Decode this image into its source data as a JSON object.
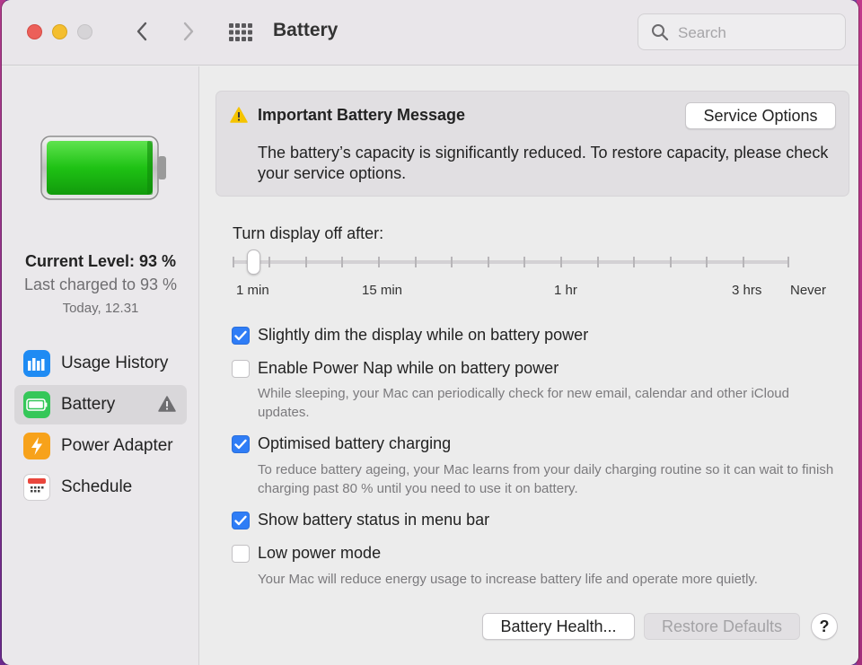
{
  "window": {
    "title": "Battery",
    "search_placeholder": "Search"
  },
  "sidebar": {
    "level_current": "Current Level: 93 %",
    "level_last_charged": "Last charged to 93 %",
    "level_time": "Today, 12.31",
    "items": [
      {
        "label": "Usage History",
        "icon": "bar-chart-icon",
        "color": "#1f8bf3"
      },
      {
        "label": "Battery",
        "icon": "battery-icon",
        "color": "#35c759",
        "active": true,
        "warning": true
      },
      {
        "label": "Power Adapter",
        "icon": "lightning-icon",
        "color": "#f7a21b"
      },
      {
        "label": "Schedule",
        "icon": "calendar-icon",
        "color": "#e9463c"
      }
    ]
  },
  "message": {
    "title": "Important Battery Message",
    "body": "The battery’s capacity is significantly reduced. To restore capacity, please check your service options.",
    "button": "Service Options"
  },
  "display_off": {
    "label": "Turn display off after:",
    "tick_labels": [
      "1 min",
      "15 min",
      "1 hr",
      "3 hrs",
      "Never"
    ],
    "value": "1 min"
  },
  "options": [
    {
      "label": "Slightly dim the display while on battery power",
      "checked": true,
      "description": ""
    },
    {
      "label": "Enable Power Nap while on battery power",
      "checked": false,
      "description": "While sleeping, your Mac can periodically check for new email, calendar and other iCloud updates."
    },
    {
      "label": "Optimised battery charging",
      "checked": true,
      "description": "To reduce battery ageing, your Mac learns from your daily charging routine so it can wait to finish charging past 80 % until you need to use it on battery."
    },
    {
      "label": "Show battery status in menu bar",
      "checked": true,
      "description": ""
    },
    {
      "label": "Low power mode",
      "checked": false,
      "description": "Your Mac will reduce energy usage to increase battery life and operate more quietly."
    }
  ],
  "footer": {
    "health_button": "Battery Health...",
    "restore_button": "Restore Defaults",
    "help_button": "?"
  },
  "colors": {
    "accent": "#2f7df6",
    "battery_green": "#22c41a",
    "warning": "#f5c400"
  }
}
